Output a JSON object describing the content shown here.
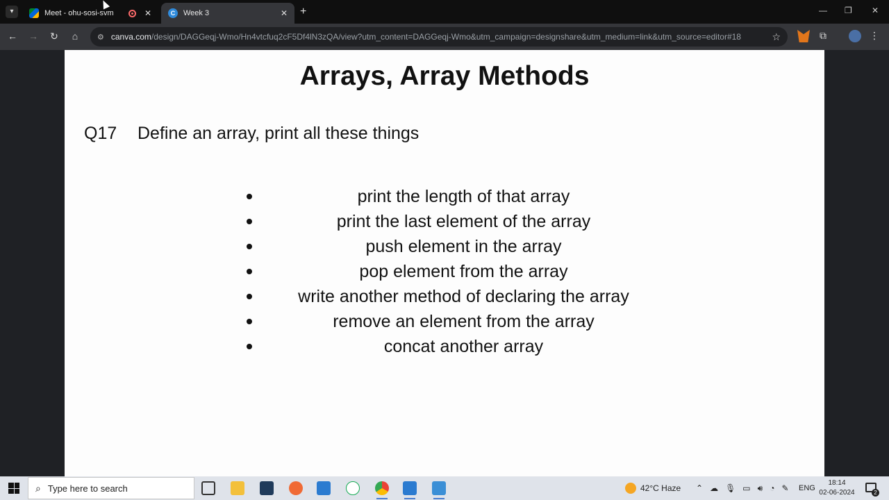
{
  "browser": {
    "tabs": [
      {
        "title": "Meet - ohu-sosi-svm",
        "icon": "google-meet-icon",
        "recording": true
      },
      {
        "title": "Week 3",
        "icon": "canva-icon",
        "active": true
      }
    ],
    "url_host": "canva.com",
    "url_path": "/design/DAGGeqj-Wmo/Hn4vtcfuq2cF5Df4lN3zQA/view?utm_content=DAGGeqj-Wmo&utm_campaign=designshare&utm_medium=link&utm_source=editor#18"
  },
  "slide": {
    "title": "Arrays, Array Methods",
    "question_number": "Q17",
    "question_text": "Define an array, print all these things",
    "bullets": [
      "print the length of that array",
      "print the last element of the array",
      "push element in the array",
      "pop element from the array",
      "write another method of declaring the array",
      "remove an element from the array",
      "concat another array"
    ]
  },
  "taskbar": {
    "search_placeholder": "Type here to search",
    "weather": "42°C  Haze",
    "language": "ENG",
    "time": "18:14",
    "date": "02-06-2024",
    "notification_count": "2"
  }
}
